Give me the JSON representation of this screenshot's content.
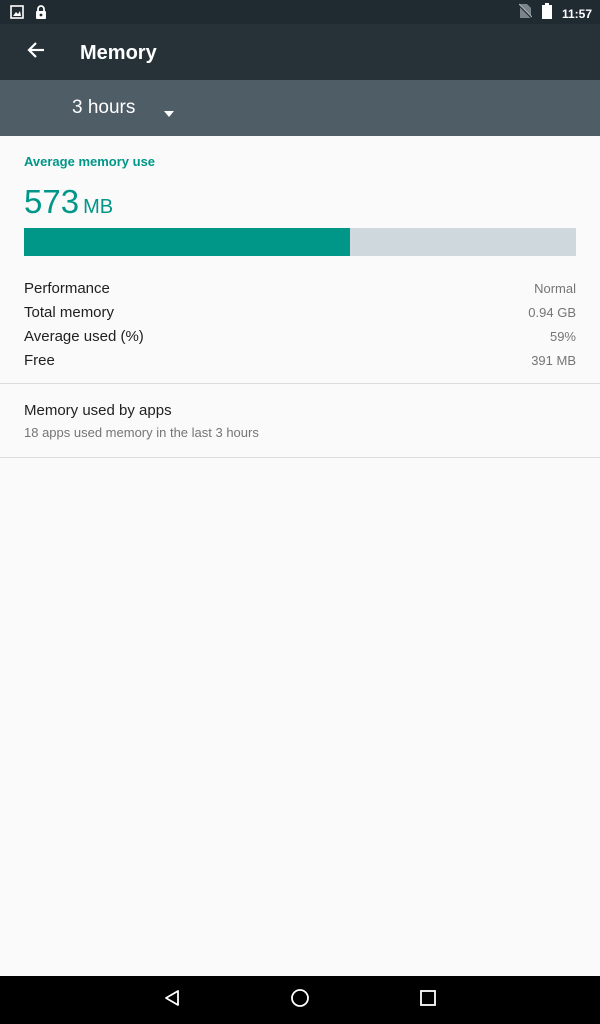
{
  "status_bar": {
    "time": "11:57",
    "left_icons": [
      "image-notification-icon",
      "lock-icon"
    ],
    "right_icons": [
      "no-sim-icon",
      "battery-icon"
    ]
  },
  "app_bar": {
    "title": "Memory"
  },
  "filter": {
    "selected_period": "3 hours"
  },
  "memory": {
    "section_header": "Average memory use",
    "average_value": "573",
    "average_unit": "MB",
    "usage_fraction": 0.59,
    "stats": [
      {
        "label": "Performance",
        "value": "Normal"
      },
      {
        "label": "Total memory",
        "value": "0.94 GB"
      },
      {
        "label": "Average used (%)",
        "value": "59%"
      },
      {
        "label": "Free",
        "value": "391 MB"
      }
    ]
  },
  "apps_item": {
    "title": "Memory used by apps",
    "subtitle": "18 apps used memory in the last 3 hours"
  },
  "colors": {
    "accent": "#009688",
    "app_bar": "#263238",
    "filter_bar": "#4e5d66",
    "bar_track": "#cfd8dc"
  }
}
